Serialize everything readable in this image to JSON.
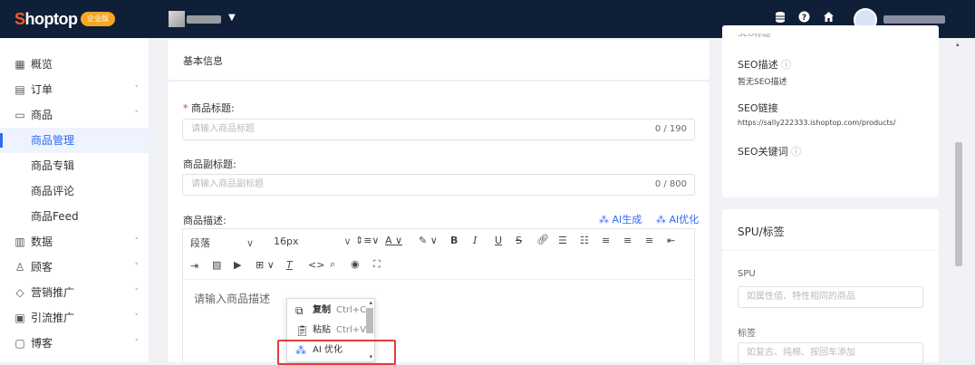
{
  "header": {
    "logo_prefix": "S",
    "logo_rest": "hoptop",
    "edition_badge": "企业版",
    "store_dropdown_caret": "▼",
    "icons": [
      "database-icon",
      "help-icon",
      "home-icon"
    ]
  },
  "sidebar": {
    "items": [
      {
        "label": "概览",
        "icon": "overview-icon",
        "chevron": ""
      },
      {
        "label": "订单",
        "icon": "order-icon",
        "chevron": "˅"
      },
      {
        "label": "商品",
        "icon": "product-icon",
        "chevron": "˄"
      },
      {
        "label": "商品管理",
        "icon": "",
        "chevron": ""
      },
      {
        "label": "商品专辑",
        "icon": "",
        "chevron": ""
      },
      {
        "label": "商品评论",
        "icon": "",
        "chevron": ""
      },
      {
        "label": "商品Feed",
        "icon": "",
        "chevron": ""
      },
      {
        "label": "数据",
        "icon": "data-icon",
        "chevron": "˅"
      },
      {
        "label": "顾客",
        "icon": "customer-icon",
        "chevron": "˅"
      },
      {
        "label": "营销推广",
        "icon": "marketing-icon",
        "chevron": "˅"
      },
      {
        "label": "引流推广",
        "icon": "traffic-icon",
        "chevron": "˅"
      },
      {
        "label": "博客",
        "icon": "blog-icon",
        "chevron": "˅"
      }
    ],
    "active_item": "商品管理"
  },
  "main": {
    "section_title": "基本信息",
    "title_label": "商品标题:",
    "required_mark": "*",
    "title_placeholder": "请输入商品标题",
    "title_counter": "0 / 190",
    "subtitle_label": "商品副标题:",
    "subtitle_placeholder": "请输入商品副标题",
    "subtitle_counter": "0 / 800",
    "desc_label": "商品描述:",
    "ai_generate": "AI生成",
    "ai_optimize": "AI优化",
    "toolbar": {
      "paragraph": "段落",
      "font_size": "16px",
      "bold": "B",
      "italic": "I",
      "underline": "U",
      "strike": "S"
    },
    "editor_placeholder": "请输入商品描述"
  },
  "context_menu": {
    "items": [
      {
        "label": "复制",
        "shortcut": "Ctrl+C",
        "icon": "copy-icon"
      },
      {
        "label": "粘贴",
        "shortcut": "Ctrl+V",
        "icon": "paste-icon"
      },
      {
        "label": "AI 优化",
        "shortcut": "",
        "icon": "ai-wand-icon"
      }
    ]
  },
  "seo": {
    "cut_top": "SEO标题",
    "desc_label": "SEO描述",
    "desc_value": "暂无SEO描述",
    "link_label": "SEO链接",
    "link_value": "https://sally222333.ishoptop.com/products/",
    "keywords_label": "SEO关键词"
  },
  "spu_card": {
    "title": "SPU/标签",
    "spu_label": "SPU",
    "spu_placeholder": "如属性值、特性相同的商品",
    "tag_label": "标签",
    "tag_placeholder": "如复古、纯棉、按回车添加"
  }
}
